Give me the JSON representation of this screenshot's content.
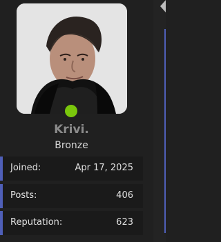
{
  "profile": {
    "username": "Krivi.",
    "rank": "Bronze",
    "status_color": "#7ac70c"
  },
  "stats": [
    {
      "label": "Joined:",
      "value": "Apr 17, 2025"
    },
    {
      "label": "Posts:",
      "value": "406"
    },
    {
      "label": "Reputation:",
      "value": "623"
    }
  ],
  "colors": {
    "accent": "#4f5fb8",
    "background": "#202020",
    "text_muted": "#8b8b8b"
  }
}
